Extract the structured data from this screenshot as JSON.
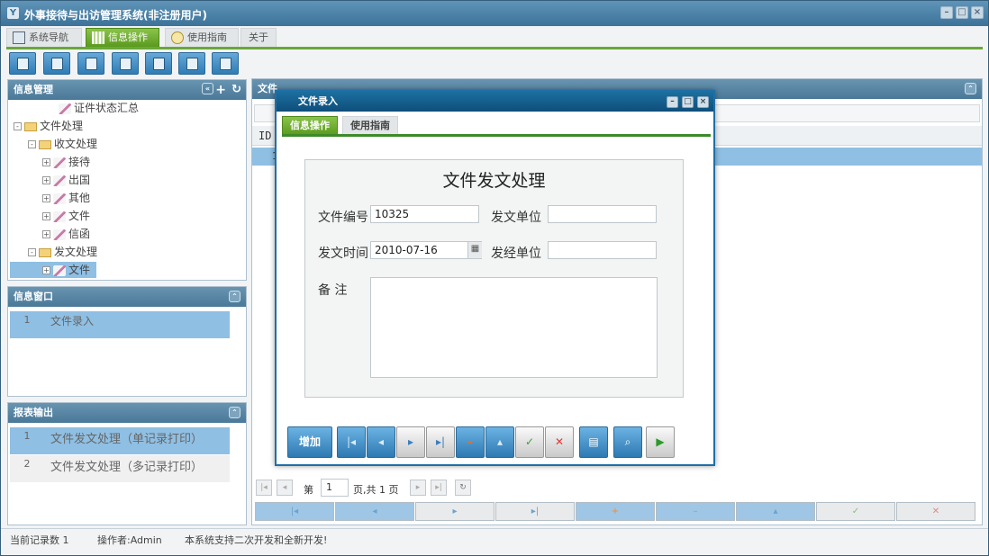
{
  "window": {
    "title": "外事接待与出访管理系统(非注册用户)"
  },
  "tabs": [
    {
      "label": "系统导航"
    },
    {
      "label": "信息操作"
    },
    {
      "label": "使用指南"
    },
    {
      "label": "关于"
    }
  ],
  "left_panel": {
    "title": "信息管理",
    "tree": [
      {
        "label": "证件状态汇总"
      },
      {
        "label": "文件处理"
      },
      {
        "label": "收文处理"
      },
      {
        "label": "接待"
      },
      {
        "label": "出国"
      },
      {
        "label": "其他"
      },
      {
        "label": "文件"
      },
      {
        "label": "信函"
      },
      {
        "label": "发文处理"
      },
      {
        "label": "文件"
      }
    ]
  },
  "info_window": {
    "title": "信息窗口",
    "rows": [
      {
        "num": "1",
        "text": "文件录入"
      }
    ]
  },
  "report_output": {
    "title": "报表输出",
    "rows": [
      {
        "num": "1",
        "text": "文件发文处理（单记录打印）"
      },
      {
        "num": "2",
        "text": "文件发文处理（多记录打印）"
      }
    ]
  },
  "main_panel": {
    "title": "文件",
    "id_header": "ID",
    "id_first": "1"
  },
  "pager": {
    "page_label": "第",
    "page_value": "1",
    "page_total": "页,共 1 页"
  },
  "dialog": {
    "title": "文件录入",
    "tabs": [
      {
        "label": "信息操作"
      },
      {
        "label": "使用指南"
      }
    ],
    "form_title": "文件发文处理",
    "fields": {
      "doc_no_label": "文件编号",
      "doc_no": "10325",
      "dept_label": "发文单位",
      "dept": "",
      "date_label": "发文时间",
      "date": "2010-07-16",
      "handler_label": "发经单位",
      "handler": "",
      "remark_label": "备 注",
      "remark": ""
    },
    "add_label": "增加"
  },
  "status_bar": {
    "records": "当前记录数 1",
    "operator": "操作者:Admin",
    "notice": "本系统支持二次开发和全新开发!"
  },
  "colors": {
    "accent_green": "#6aa83a",
    "accent_blue": "#2d79b2",
    "header_blue": "#4a7898"
  }
}
